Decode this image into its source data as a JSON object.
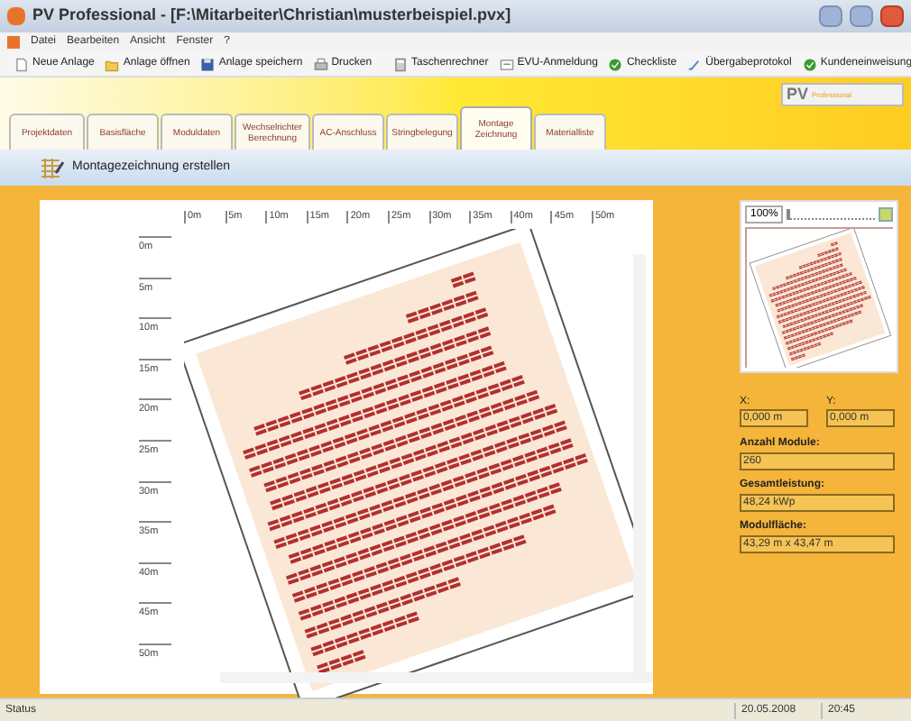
{
  "window": {
    "title": "PV Professional - [F:\\Mitarbeiter\\Christian\\musterbeispiel.pvx]"
  },
  "menu": [
    "Datei",
    "Bearbeiten",
    "Ansicht",
    "Fenster",
    "?"
  ],
  "toolbar": [
    {
      "label": "Neue Anlage",
      "kind": "document"
    },
    {
      "label": "Anlage öffnen",
      "kind": "folder"
    },
    {
      "label": "Anlage speichern",
      "kind": "disk"
    },
    {
      "label": "Drucken",
      "kind": "printer"
    },
    {
      "label": "Taschenrechner",
      "kind": "calculator"
    },
    {
      "label": "EVU-Anmeldung",
      "kind": "form"
    },
    {
      "label": "Checkliste",
      "kind": "check"
    },
    {
      "label": "Übergabeprotokol",
      "kind": "pen"
    },
    {
      "label": "Kundeneinweisung",
      "kind": "check"
    }
  ],
  "logo": {
    "name": "PV",
    "subtitle": "Professional"
  },
  "tabs": [
    {
      "label": "Projektdaten",
      "selected": false
    },
    {
      "label": "Basisfläche",
      "selected": false
    },
    {
      "label": "Moduldaten",
      "selected": false
    },
    {
      "label": "Wechselrichter Berechnung",
      "selected": false
    },
    {
      "label": "AC-Anschluss",
      "selected": false
    },
    {
      "label": "Stringbelegung",
      "selected": false
    },
    {
      "label": "Montage Zeichnung",
      "selected": true
    },
    {
      "label": "Materialliste",
      "selected": false
    }
  ],
  "action": {
    "label": "Montagezeichnung erstellen"
  },
  "ruler_x": [
    "0m",
    "5m",
    "10m",
    "15m",
    "20m",
    "25m",
    "30m",
    "35m",
    "40m",
    "45m",
    "50m"
  ],
  "ruler_y": [
    "0m",
    "5m",
    "10m",
    "15m",
    "20m",
    "25m",
    "30m",
    "35m",
    "40m",
    "45m",
    "50m"
  ],
  "zoom": {
    "value": "100%",
    "level": 0
  },
  "coords": [
    {
      "label": "X:",
      "value": "0,000 m"
    },
    {
      "label": "Y:",
      "value": "0,000 m"
    }
  ],
  "fields": [
    {
      "label": "Anzahl Module:",
      "value": "260"
    },
    {
      "label": "Gesamtleistung:",
      "value": "48,24 kWp"
    },
    {
      "label": "Modulfläche:",
      "value": "43,29 m x 43,47 m"
    }
  ],
  "status_bar": {
    "text": "Status",
    "date": "20.05.2008",
    "time": "20:45"
  }
}
